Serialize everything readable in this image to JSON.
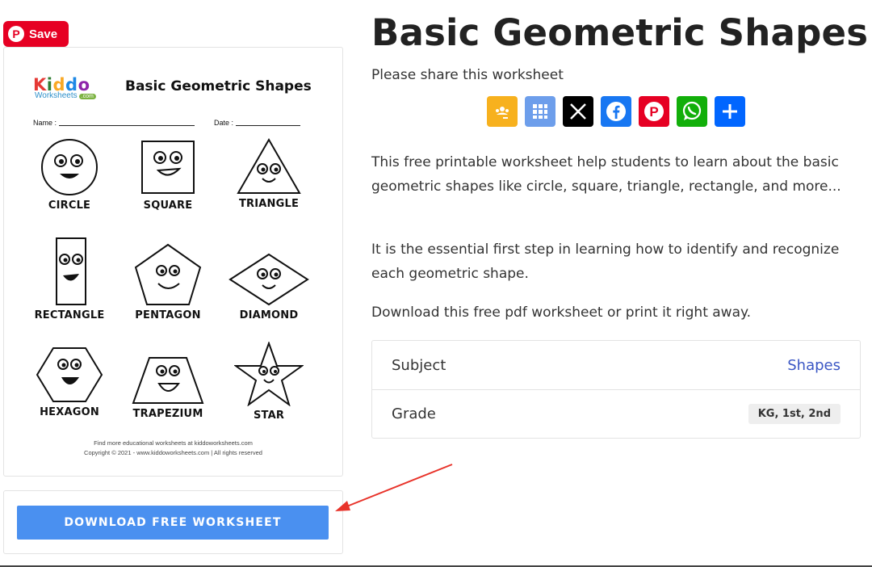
{
  "pin_save": {
    "label": "Save",
    "icon": "pinterest-icon"
  },
  "worksheet": {
    "logo_main": "Kiddo",
    "logo_sub": "Worksheets",
    "logo_com": ".com",
    "title": "Basic Geometric Shapes",
    "name_label": "Name :",
    "date_label": "Date :",
    "shapes": [
      "CIRCLE",
      "SQUARE",
      "TRIANGLE",
      "RECTANGLE",
      "PENTAGON",
      "DIAMOND",
      "HEXAGON",
      "TRAPEZIUM",
      "STAR"
    ],
    "footer_line1": "Find more educational worksheets at kiddoworksheets.com",
    "footer_line2": "Copyright © 2021 - www.kiddoworksheets.com  |  All rights reserved"
  },
  "download": {
    "label": "DOWNLOAD FREE WORKSHEET"
  },
  "main": {
    "title": "Basic Geometric Shapes",
    "share_label": "Please share this worksheet",
    "desc1": "This free printable worksheet help students to learn about the basic geometric shapes like circle, square, triangle, rectangle, and more...",
    "desc2": "It is the essential first step in learning how to identify and recognize each geometric shape.",
    "desc3": "Download this free pdf worksheet or print it right away."
  },
  "share_buttons": [
    {
      "name": "google-classroom",
      "color": "#f7b11e"
    },
    {
      "name": "microsoft-teams",
      "color": "#6d9eeb"
    },
    {
      "name": "x",
      "color": "#000000"
    },
    {
      "name": "facebook",
      "color": "#1877f2"
    },
    {
      "name": "pinterest",
      "color": "#e60023"
    },
    {
      "name": "whatsapp",
      "color": "#12af0a"
    },
    {
      "name": "share",
      "color": "#0166ff"
    }
  ],
  "meta": {
    "subject_key": "Subject",
    "subject_value": "Shapes",
    "grade_key": "Grade",
    "grade_value": "KG, 1st, 2nd"
  },
  "colors": {
    "accent_blue": "#4a90f0",
    "link_blue": "#3b57c4",
    "pinterest_red": "#e60023",
    "arrow_red": "#e8332a"
  }
}
